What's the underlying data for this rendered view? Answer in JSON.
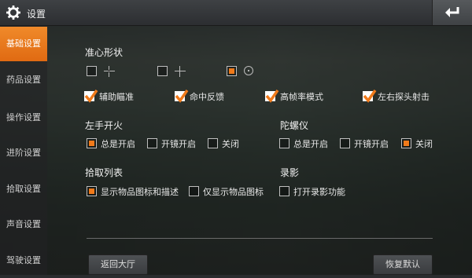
{
  "header": {
    "title": "设置"
  },
  "sidebar": {
    "items": [
      {
        "label": "基础设置",
        "active": true
      },
      {
        "label": "药品设置"
      },
      {
        "label": "操作设置"
      },
      {
        "label": "进阶设置"
      },
      {
        "label": "拾取设置"
      },
      {
        "label": "声音设置"
      },
      {
        "label": "驾驶设置"
      }
    ]
  },
  "crosshair": {
    "title": "准心形状",
    "selected_index": 2
  },
  "options": {
    "assist_aim": "辅助瞄准",
    "hit_feedback": "命中反馈",
    "high_fps": "高帧率模式",
    "peek_fire": "左右探头射击"
  },
  "left_fire": {
    "title": "左手开火",
    "options": [
      "总是开启",
      "开镜开启",
      "关闭"
    ],
    "selected": 0
  },
  "gyro": {
    "title": "陀螺仪",
    "options": [
      "总是开启",
      "开镜开启",
      "关闭"
    ],
    "selected": 2
  },
  "pickup": {
    "title": "拾取列表",
    "options": [
      "显示物品图标和描述",
      "仅显示物品图标"
    ],
    "selected": 0
  },
  "record": {
    "title": "录影",
    "option": "打开录影功能"
  },
  "footer": {
    "back_lobby": "返回大厅",
    "restore_default": "恢复默认"
  },
  "colors": {
    "accent": "#f07a1a"
  }
}
